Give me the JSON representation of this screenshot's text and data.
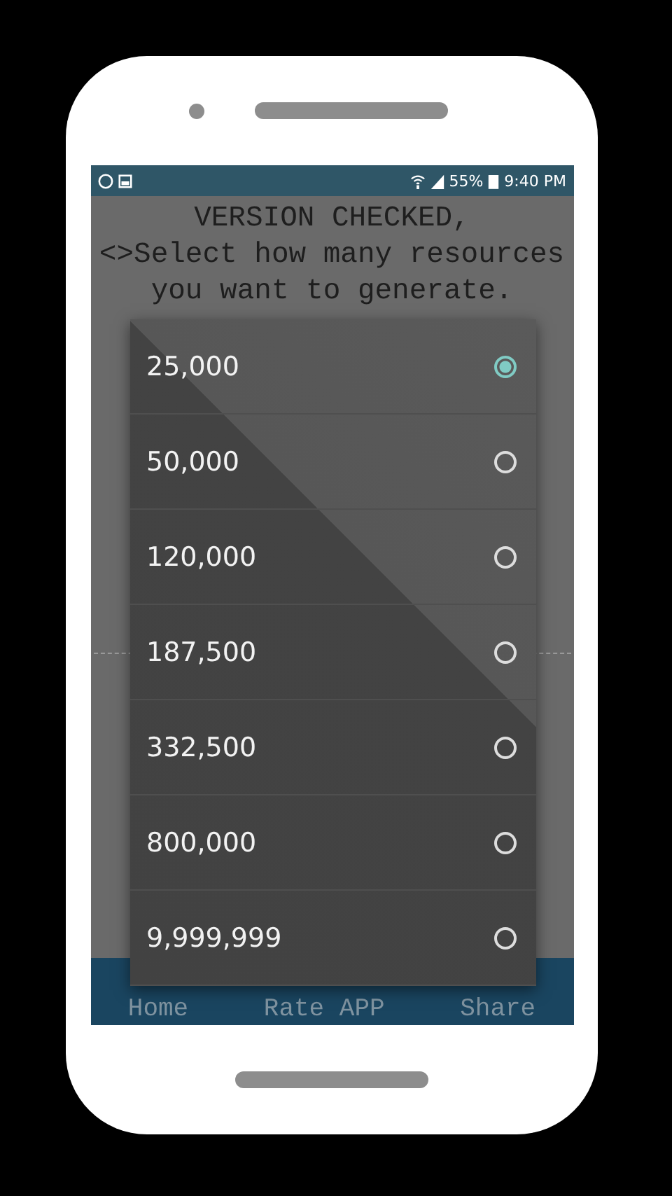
{
  "status_bar": {
    "battery": "55%",
    "time": "9:40 PM"
  },
  "message": [
    "VERSION CHECKED,",
    "<>Select how many resources",
    "you want to generate."
  ],
  "nav": [
    {
      "label": "Home"
    },
    {
      "label": "Rate APP"
    },
    {
      "label": "Share"
    }
  ],
  "dialog": {
    "options": [
      {
        "label": "25,000",
        "selected": true
      },
      {
        "label": "50,000",
        "selected": false
      },
      {
        "label": "120,000",
        "selected": false
      },
      {
        "label": "187,500",
        "selected": false
      },
      {
        "label": "332,500",
        "selected": false
      },
      {
        "label": "800,000",
        "selected": false
      },
      {
        "label": "9,999,999",
        "selected": false
      }
    ]
  }
}
